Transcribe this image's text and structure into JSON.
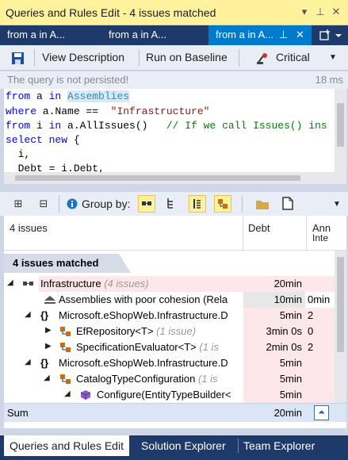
{
  "window": {
    "title": "Queries and Rules Edit  - 4 issues matched",
    "title_buttons": {
      "dropdown": "▾",
      "pin": "⊥",
      "close": "✕"
    }
  },
  "tabs": [
    {
      "label": "from a in A..."
    },
    {
      "label": "from a in A..."
    },
    {
      "label": "from a in A..."
    }
  ],
  "toolbar": {
    "view_description": "View Description",
    "run_on_baseline": "Run on Baseline",
    "severity": "Critical"
  },
  "status": {
    "message": "The query is not persisted!",
    "elapsed": "18 ms"
  },
  "code": {
    "line1": [
      "from",
      " a ",
      "in",
      " ",
      "Assemblies"
    ],
    "line2": [
      "where",
      " a.Name ==  ",
      "\"Infrastructure\""
    ],
    "line3": [
      "from",
      " i ",
      "in",
      " a.AllIssues()   ",
      "// If we call Issues() ins"
    ],
    "line4": [
      "select",
      " ",
      "new",
      " {"
    ],
    "line5": "  i,",
    "line6": "  Debt = i.Debt,"
  },
  "results_toolbar": {
    "group_by_label": "Group by:"
  },
  "grid": {
    "headers": {
      "name": "4 issues",
      "debt": "Debt",
      "ann1": "Ann",
      "ann2": "Inte"
    },
    "group_label": "4 issues matched",
    "rows": [
      {
        "name": "Infrastructure",
        "count": "(4 issues)",
        "debt": "20min",
        "ai": ""
      },
      {
        "name": "Assemblies with poor cohesion (Rela",
        "count": "",
        "debt": "10min",
        "ai": "0min"
      },
      {
        "name": "Microsoft.eShopWeb.Infrastructure.D",
        "count": "",
        "debt": "5min",
        "ai": "2"
      },
      {
        "name": "EfRepository<T>",
        "count": "(1 issue)",
        "debt": "3min  0s",
        "ai": "0"
      },
      {
        "name": "SpecificationEvaluator<T>",
        "count": "(1 is",
        "debt": "2min  0s",
        "ai": "2"
      },
      {
        "name": "Microsoft.eShopWeb.Infrastructure.D",
        "count": "",
        "debt": "5min",
        "ai": ""
      },
      {
        "name": "CatalogTypeConfiguration",
        "count": "(1 is",
        "debt": "5min",
        "ai": ""
      },
      {
        "name": "Configure(EntityTypeBuilder<",
        "count": "",
        "debt": "5min",
        "ai": ""
      }
    ],
    "sum": {
      "label": "Sum",
      "debt": "20min"
    }
  },
  "bottom_tabs": [
    {
      "label": "Queries and Rules Edit"
    },
    {
      "label": "Solution Explorer"
    },
    {
      "label": "Team Explorer"
    }
  ],
  "colors": {
    "accent": "#007acc",
    "title_bg": "#fff29d",
    "dark_bar": "#1e3a6b",
    "row_highlight": "#fde7ea"
  }
}
